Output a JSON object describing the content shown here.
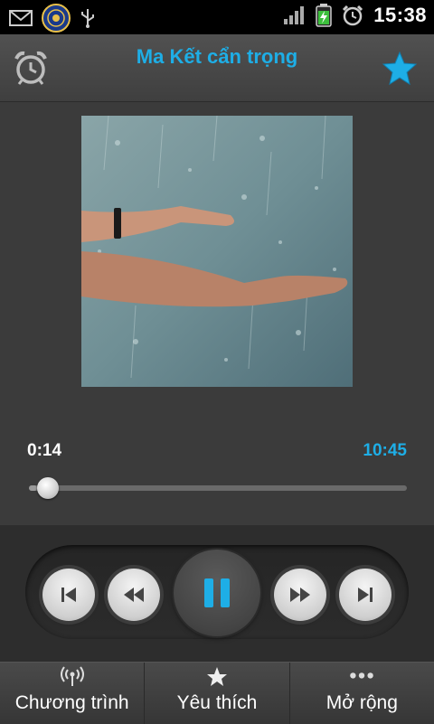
{
  "status_bar": {
    "time": "15:38",
    "icons": [
      "gmail-icon",
      "astrology-app-icon",
      "usb-icon",
      "signal-icon",
      "battery-charging-icon",
      "alarm-icon"
    ]
  },
  "header": {
    "title": "Ma Kết cẩn trọng",
    "alarm_icon": "alarm-clock-icon",
    "favorite_icon": "star-icon"
  },
  "player": {
    "elapsed": "0:14",
    "total": "10:45",
    "progress_fraction": 0.022
  },
  "controls": {
    "buttons": [
      "skip-previous-icon",
      "rewind-icon",
      "pause-icon",
      "fast-forward-icon",
      "skip-next-icon"
    ]
  },
  "tabs": [
    {
      "label": "Chương trình",
      "icon": "broadcast-icon"
    },
    {
      "label": "Yêu thích",
      "icon": "star-icon"
    },
    {
      "label": "Mở rộng",
      "icon": "more-dots-icon"
    }
  ],
  "colors": {
    "accent": "#1eaee6",
    "background": "#3b3b3b",
    "status_bar": "#000000"
  }
}
